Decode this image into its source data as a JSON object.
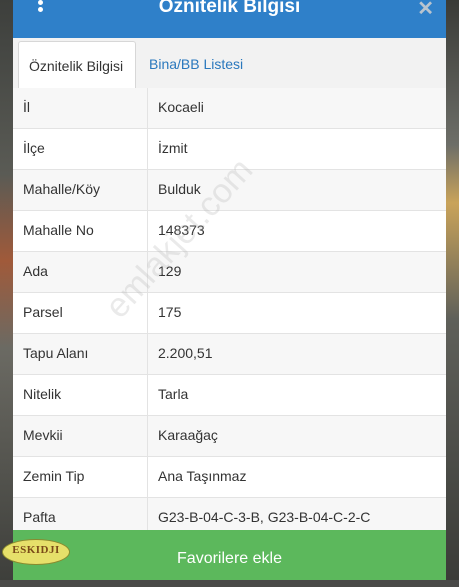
{
  "header": {
    "title": "Öznitelik Bilgisi",
    "menu_icon": "vertical-dots-icon",
    "close_icon": "close-icon"
  },
  "tabs": [
    {
      "label": "Öznitelik Bilgisi",
      "active": true
    },
    {
      "label": "Bina/BB Listesi",
      "active": false
    }
  ],
  "rows": [
    {
      "key": "İl",
      "value": "Kocaeli"
    },
    {
      "key": "İlçe",
      "value": "İzmit"
    },
    {
      "key": "Mahalle/Köy",
      "value": "Bulduk"
    },
    {
      "key": "Mahalle No",
      "value": "148373"
    },
    {
      "key": "Ada",
      "value": "129"
    },
    {
      "key": "Parsel",
      "value": "175"
    },
    {
      "key": "Tapu Alanı",
      "value": "2.200,51"
    },
    {
      "key": "Nitelik",
      "value": "Tarla"
    },
    {
      "key": "Mevkii",
      "value": "Karaağaç"
    },
    {
      "key": "Zemin Tip",
      "value": "Ana Taşınmaz"
    },
    {
      "key": "Pafta",
      "value": "G23-B-04-C-3-B, G23-B-04-C-2-C"
    }
  ],
  "footer": {
    "button_label": "Favorilere ekle"
  },
  "logo": {
    "text": "ESKIDJI"
  },
  "watermark": {
    "text": "emlakjet.com"
  },
  "colors": {
    "header": "#2f80c9",
    "footer": "#5cb85c",
    "tab_link": "#2a78bd"
  }
}
